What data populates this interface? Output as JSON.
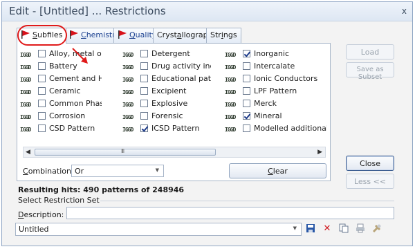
{
  "window": {
    "title": "Edit - [Untitled] ... Restrictions",
    "close_glyph": "x"
  },
  "tabs": [
    {
      "label": "Subfiles",
      "underline": "S",
      "rest": "ubfiles",
      "flag": true,
      "active": true
    },
    {
      "label": "Chemistry",
      "underline": "C",
      "rest": "hemistry",
      "flag": true
    },
    {
      "label": "Quality",
      "underline": "Q",
      "rest": "uality",
      "flag": true
    },
    {
      "label": "Crystallography",
      "pre": "Cryst",
      "underline": "a",
      "rest": "llography"
    },
    {
      "label": "Strings",
      "pre": "Str",
      "underline": "i",
      "rest": "ngs"
    }
  ],
  "icon_text": "IGGD",
  "subfiles": {
    "col1": [
      {
        "label": "Alloy, metal or intermetallic",
        "checked": false
      },
      {
        "label": "Battery",
        "checked": false
      },
      {
        "label": "Cement and Hydration Product",
        "checked": false
      },
      {
        "label": "Ceramic",
        "checked": false
      },
      {
        "label": "Common Phase",
        "checked": false
      },
      {
        "label": "Corrosion",
        "checked": false
      },
      {
        "label": "CSD Pattern",
        "checked": false
      }
    ],
    "col2": [
      {
        "label": "Detergent",
        "checked": false
      },
      {
        "label": "Drug activity index",
        "checked": false
      },
      {
        "label": "Educational pattern",
        "checked": false
      },
      {
        "label": "Excipient",
        "checked": false
      },
      {
        "label": "Explosive",
        "checked": false
      },
      {
        "label": "Forensic",
        "checked": false
      },
      {
        "label": "ICSD Pattern",
        "checked": true
      }
    ],
    "col3": [
      {
        "label": "Inorganic",
        "checked": true
      },
      {
        "label": "Intercalate",
        "checked": false
      },
      {
        "label": "Ionic Conductors",
        "checked": false
      },
      {
        "label": "LPF Pattern",
        "checked": false
      },
      {
        "label": "Merck",
        "checked": false
      },
      {
        "label": "Mineral",
        "checked": true
      },
      {
        "label": "Modelled additional pattern",
        "checked": false
      }
    ]
  },
  "scrollbar": {
    "grip": "III",
    "left_arrow": "◀",
    "right_arrow": "▶"
  },
  "combination": {
    "label_u": "C",
    "label_rest": "ombination:",
    "value": "Or"
  },
  "buttons": {
    "clear_u": "C",
    "clear_rest": "lear",
    "load": "Load",
    "save_as_subset": "Save as Subset",
    "close": "Close",
    "less": "Less <<"
  },
  "resulting_hits": "Resulting hits: 490 patterns of 248946",
  "select_restriction_set": "Select Restriction Set",
  "description": {
    "label_u": "D",
    "label_rest": "escription:",
    "value": ""
  },
  "restriction_set": {
    "value": "Untitled"
  },
  "colors": {
    "accent_red": "#e01a1a",
    "border": "#a7b5c8",
    "title_text": "#3a4a5e"
  }
}
